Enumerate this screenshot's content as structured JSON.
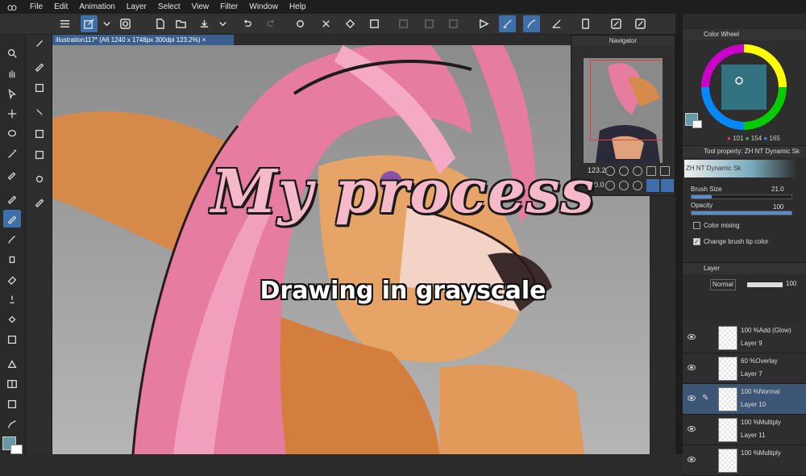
{
  "menubar": {
    "items": [
      "File",
      "Edit",
      "Animation",
      "Layer",
      "Select",
      "View",
      "Filter",
      "Window",
      "Help"
    ]
  },
  "document_tab": {
    "label": "illustration117* (A6 1240 x 1748px 300dpi 123.2%)"
  },
  "navigator": {
    "title": "Navigator",
    "zoom": "123.2",
    "rotation": "0.0"
  },
  "color_wheel": {
    "title": "Color Wheel",
    "r": "101",
    "g": "154",
    "b": "165",
    "current_color": "#659aa5"
  },
  "tool_property": {
    "title": "Tool property: ZH NT Dynamic Sk",
    "brush_name": "ZH NT Dynamic Sk",
    "brush_size_label": "Brush Size",
    "brush_size_value": "21.0",
    "opacity_label": "Opacity",
    "opacity_value": "100",
    "color_mixing_label": "Color mixing",
    "change_tip_color_label": "Change brush tip color"
  },
  "layer_panel": {
    "title": "Layer",
    "blend_mode": "Normal",
    "opacity": "100",
    "layers": [
      {
        "mode": "100 %Add (Glow)",
        "name": "Layer 9"
      },
      {
        "mode": "60 %Overlay",
        "name": "Layer 7"
      },
      {
        "mode": "100 %Normal",
        "name": "Layer 10"
      },
      {
        "mode": "100 %Multiply",
        "name": "Layer 11"
      },
      {
        "mode": "100 %Multiply",
        "name": ""
      }
    ]
  },
  "overlay": {
    "title": "My process",
    "subtitle": "Drawing in grayscale"
  },
  "colors": {
    "accent": "#3e6fa8",
    "title_pink": "#f6b9c9"
  }
}
